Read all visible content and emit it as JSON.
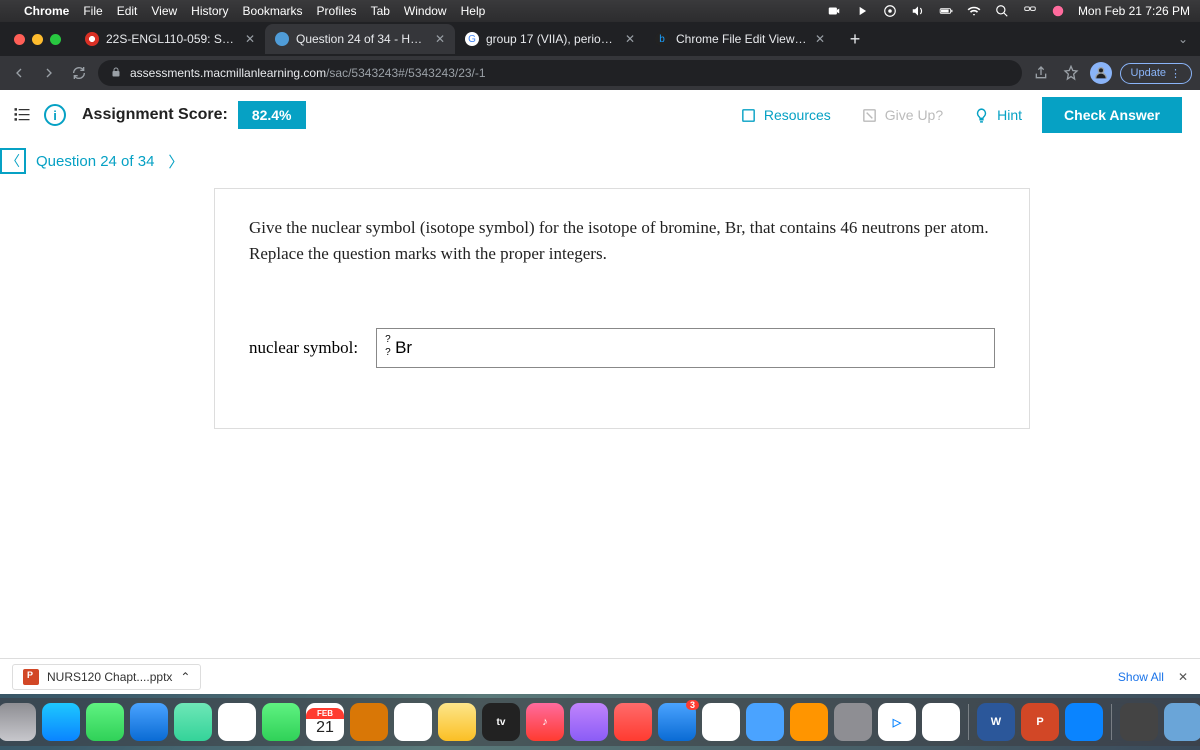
{
  "menubar": {
    "app": "Chrome",
    "items": [
      "File",
      "Edit",
      "View",
      "History",
      "Bookmarks",
      "Profiles",
      "Tab",
      "Window",
      "Help"
    ],
    "clock": "Mon Feb 21  7:26 PM"
  },
  "tabs": [
    {
      "title": "22S-ENGL110-059: Seminar in",
      "favcolor": "#d93025"
    },
    {
      "title": "Question 24 of 34 - Homework",
      "favcolor": "#4285f4",
      "active": true
    },
    {
      "title": "group 17 (VIIA), period 5 : - Go",
      "favcolor": "#fff",
      "favtext": "G"
    },
    {
      "title": "Chrome File Edit View History",
      "favcolor": "#1a73e8",
      "favtext": "b"
    }
  ],
  "url": {
    "domain": "assessments.macmillanlearning.com",
    "path": "/sac/5343243#/5343243/23/-1"
  },
  "update_label": "Update",
  "assignment": {
    "score_label": "Assignment Score:",
    "score_value": "82.4%",
    "resources": "Resources",
    "giveup": "Give Up?",
    "hint": "Hint",
    "check": "Check Answer",
    "qnav": "Question 24 of 34"
  },
  "question": {
    "prompt": "Give the nuclear symbol (isotope symbol) for the isotope of bromine, Br, that contains 46 neutrons per atom. Replace the question marks with the proper integers.",
    "answer_label": "nuclear symbol:",
    "element": "Br",
    "sup": "?",
    "sub": "?"
  },
  "download": {
    "file": "NURS120 Chapt....pptx",
    "showall": "Show All"
  },
  "calendar": {
    "month": "FEB",
    "day": "21"
  }
}
